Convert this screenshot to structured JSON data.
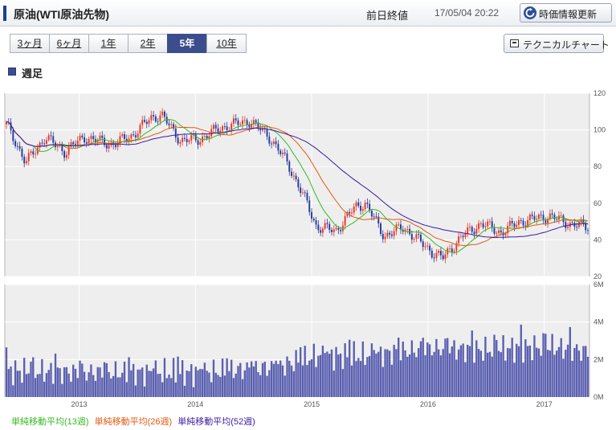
{
  "header": {
    "title": "原油(WTI原油先物)",
    "prev_close_label": "前日終値",
    "timestamp": "17/05/04 20:22",
    "refresh_label": "時価情報更新"
  },
  "tabs": [
    {
      "label": "3ヶ月",
      "active": false
    },
    {
      "label": "6ヶ月",
      "active": false
    },
    {
      "label": "1年",
      "active": false
    },
    {
      "label": "2年",
      "active": false
    },
    {
      "label": "5年",
      "active": true
    },
    {
      "label": "10年",
      "active": false
    }
  ],
  "technical_button_label": "テクニカルチャート",
  "period_label": "週足",
  "legend": [
    {
      "label": "単純移動平均(13週)",
      "color": "#33bb22"
    },
    {
      "label": "単純移動平均(26週)",
      "color": "#e05a10"
    },
    {
      "label": "単純移動平均(52週)",
      "color": "#3b1aa0"
    }
  ],
  "chart_data": [
    {
      "type": "candlestick",
      "x_labels": [
        "2013",
        "2014",
        "2015",
        "2016",
        "2017"
      ],
      "y_ticks": [
        20,
        40,
        60,
        80,
        100,
        120
      ],
      "ylim": [
        20,
        120
      ],
      "grid": true,
      "colors": {
        "up": "#e8382b",
        "down": "#2b3a9a"
      },
      "price_path": {
        "dates": [
          "2012-05",
          "2012-06",
          "2012-07",
          "2012-09",
          "2012-11",
          "2013-01",
          "2013-04",
          "2013-06",
          "2013-08",
          "2013-09",
          "2013-11",
          "2014-01",
          "2014-03",
          "2014-06",
          "2014-08",
          "2014-10",
          "2014-12",
          "2015-01",
          "2015-03",
          "2015-05",
          "2015-06",
          "2015-08",
          "2015-10",
          "2015-11",
          "2016-01",
          "2016-02",
          "2016-04",
          "2016-06",
          "2016-08",
          "2016-10",
          "2016-12",
          "2017-01",
          "2017-03",
          "2017-05"
        ],
        "values": [
          103,
          93,
          82,
          96,
          88,
          96,
          92,
          97,
          107,
          108,
          94,
          95,
          101,
          105,
          97,
          82,
          60,
          47,
          45,
          58,
          60,
          42,
          47,
          42,
          33,
          30,
          42,
          49,
          44,
          50,
          52,
          53,
          49,
          47
        ]
      },
      "moving_averages": [
        {
          "name": "単純移動平均(13週)",
          "period": 13
        },
        {
          "name": "単純移動平均(26週)",
          "period": 26
        },
        {
          "name": "単純移動平均(52週)",
          "period": 52
        }
      ]
    },
    {
      "type": "bar",
      "series_role": "volume",
      "y_ticks": [
        "0M",
        "2M",
        "4M",
        "6M"
      ],
      "ylim": [
        0,
        6
      ],
      "color": "#5a5fb0",
      "volume_path": {
        "dates": [
          "2012-05",
          "2013-01",
          "2014-01",
          "2014-09",
          "2015-01",
          "2015-06",
          "2016-01",
          "2016-06",
          "2017-01",
          "2017-05"
        ],
        "values": [
          1.4,
          1.3,
          1.3,
          1.6,
          2.2,
          2.2,
          2.6,
          2.5,
          2.7,
          2.4
        ]
      }
    }
  ]
}
